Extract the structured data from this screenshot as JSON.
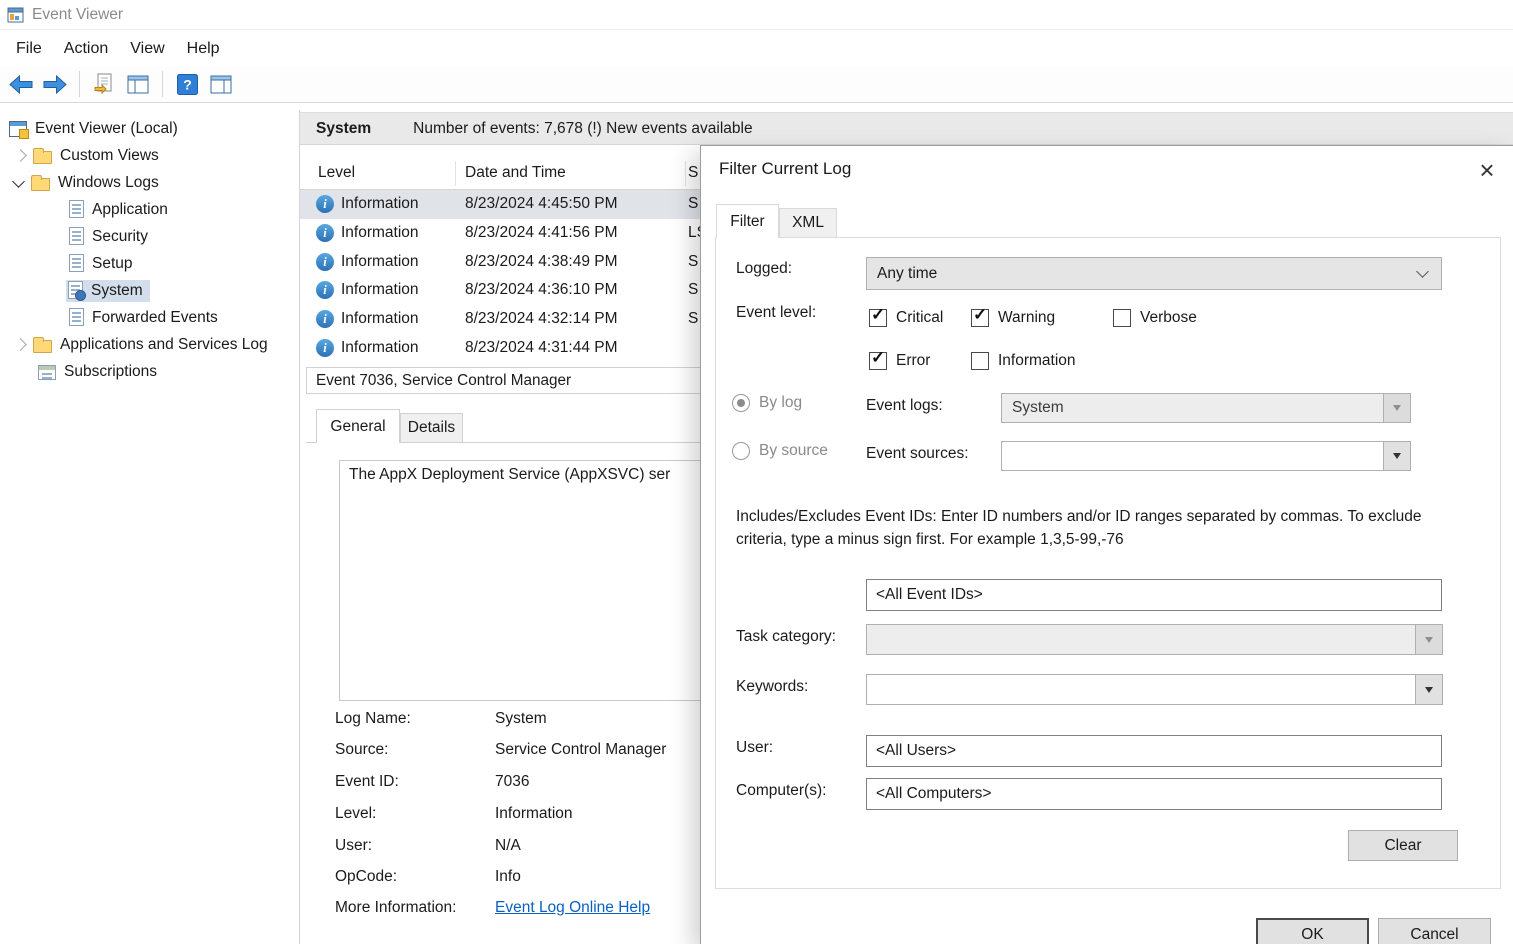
{
  "window": {
    "title": "Event Viewer"
  },
  "menubar": {
    "items": [
      "File",
      "Action",
      "View",
      "Help"
    ]
  },
  "toolbar": {
    "buttons": [
      "back",
      "forward",
      "open-saved-log",
      "show-hide-console-tree",
      "help",
      "show-hide-action-pane"
    ]
  },
  "sidebar": {
    "root_label": "Event Viewer (Local)",
    "items": [
      {
        "label": "Custom Views"
      },
      {
        "label": "Windows Logs"
      },
      {
        "label": "Application"
      },
      {
        "label": "Security"
      },
      {
        "label": "Setup"
      },
      {
        "label": "System",
        "selected": true
      },
      {
        "label": "Forwarded Events"
      },
      {
        "label": "Applications and Services Log"
      },
      {
        "label": "Subscriptions"
      }
    ]
  },
  "main": {
    "header": {
      "log_name": "System",
      "summary": "Number of events: 7,678 (!) New events available"
    },
    "table": {
      "columns": [
        "Level",
        "Date and Time",
        "S"
      ],
      "rows": [
        {
          "level": "Information",
          "datetime": "8/23/2024 4:45:50 PM",
          "source": "S",
          "selected": true
        },
        {
          "level": "Information",
          "datetime": "8/23/2024 4:41:56 PM",
          "source": "LS"
        },
        {
          "level": "Information",
          "datetime": "8/23/2024 4:38:49 PM",
          "source": "S"
        },
        {
          "level": "Information",
          "datetime": "8/23/2024 4:36:10 PM",
          "source": "S"
        },
        {
          "level": "Information",
          "datetime": "8/23/2024 4:32:14 PM",
          "source": "S"
        },
        {
          "level": "Information",
          "datetime": "8/23/2024 4:31:44 PM",
          "source": ""
        }
      ]
    },
    "detail": {
      "title": "Event 7036, Service Control Manager",
      "tabs": {
        "general": "General",
        "details": "Details"
      },
      "description": "The AppX Deployment Service (AppXSVC) ser",
      "fields": [
        {
          "label": "Log Name:",
          "value": "System"
        },
        {
          "label": "Source:",
          "value": "Service Control Manager"
        },
        {
          "label": "Event ID:",
          "value": "7036"
        },
        {
          "label": "Level:",
          "value": "Information"
        },
        {
          "label": "User:",
          "value": "N/A"
        },
        {
          "label": "OpCode:",
          "value": "Info"
        },
        {
          "label": "More Information:",
          "value": "Event Log Online Help"
        }
      ]
    }
  },
  "dialog": {
    "title": "Filter Current Log",
    "tabs": {
      "filter": "Filter",
      "xml": "XML"
    },
    "logged": {
      "label": "Logged:",
      "value": "Any time"
    },
    "event_level": {
      "label": "Event level:",
      "options": [
        {
          "label": "Critical",
          "checked": true
        },
        {
          "label": "Warning",
          "checked": true
        },
        {
          "label": "Verbose",
          "checked": false
        },
        {
          "label": "Error",
          "checked": true
        },
        {
          "label": "Information",
          "checked": false
        }
      ]
    },
    "by_log": {
      "label": "By log",
      "selected": true
    },
    "by_source": {
      "label": "By source",
      "selected": false
    },
    "event_logs": {
      "label": "Event logs:",
      "value": "System"
    },
    "event_sources": {
      "label": "Event sources:",
      "value": ""
    },
    "includes_text": "Includes/Excludes Event IDs: Enter ID numbers and/or ID ranges separated by commas. To exclude criteria, type a minus sign first. For example 1,3,5-99,-76",
    "event_ids": {
      "value": "<All Event IDs>"
    },
    "task_category": {
      "label": "Task category:",
      "value": ""
    },
    "keywords": {
      "label": "Keywords:",
      "value": ""
    },
    "user": {
      "label": "User:",
      "value": "<All Users>"
    },
    "computers": {
      "label": "Computer(s):",
      "value": "<All Computers>"
    },
    "buttons": {
      "clear": "Clear",
      "ok": "OK",
      "cancel": "Cancel"
    }
  }
}
